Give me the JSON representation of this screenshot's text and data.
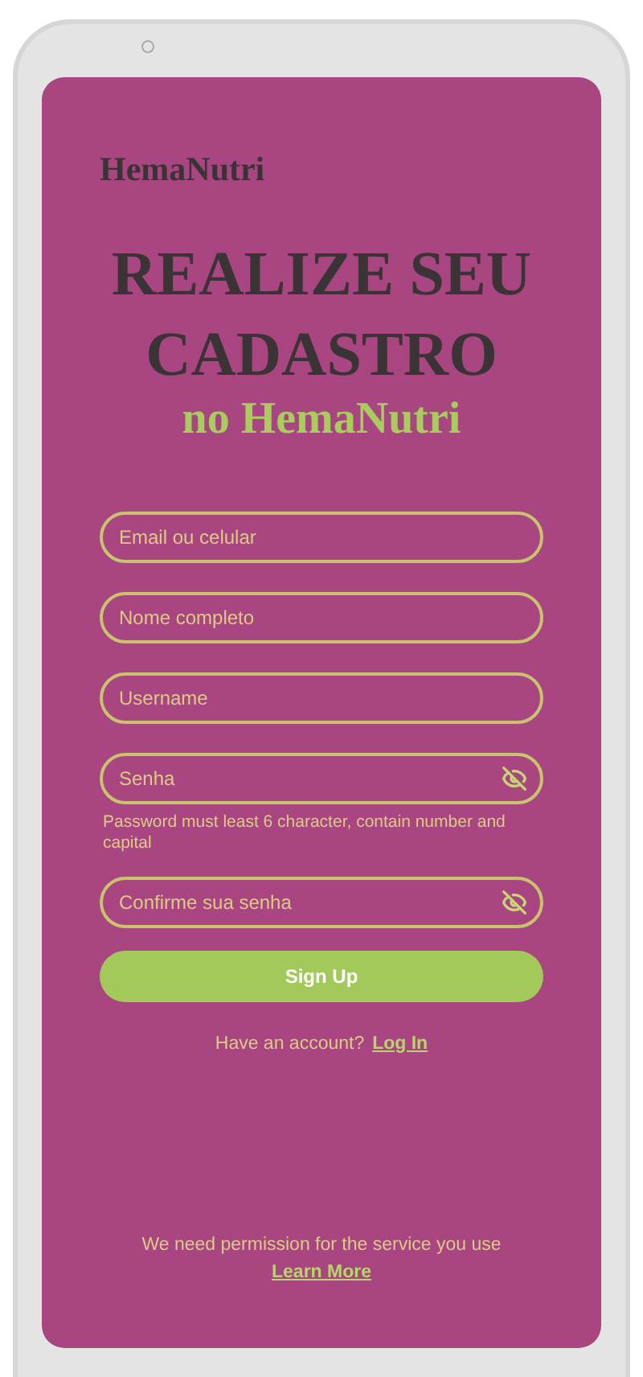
{
  "logo": "HemaNutri",
  "title": "REALIZE SEU CADASTRO",
  "subtitle": "no HemaNutri",
  "fields": [
    {
      "placeholder": "Email ou celular",
      "kind": "text"
    },
    {
      "placeholder": "Nome completo",
      "kind": "text"
    },
    {
      "placeholder": "Username",
      "kind": "text"
    },
    {
      "placeholder": "Senha",
      "kind": "password",
      "hint": "Password must least 6 character,  contain number and capital"
    },
    {
      "placeholder": "Confirme sua senha",
      "kind": "password"
    }
  ],
  "signup_button": "Sign Up",
  "login_prompt": "Have an account?",
  "login_link": "Log In",
  "permission_text": "We need permission for the service you use",
  "learn_more_link": "Learn More"
}
